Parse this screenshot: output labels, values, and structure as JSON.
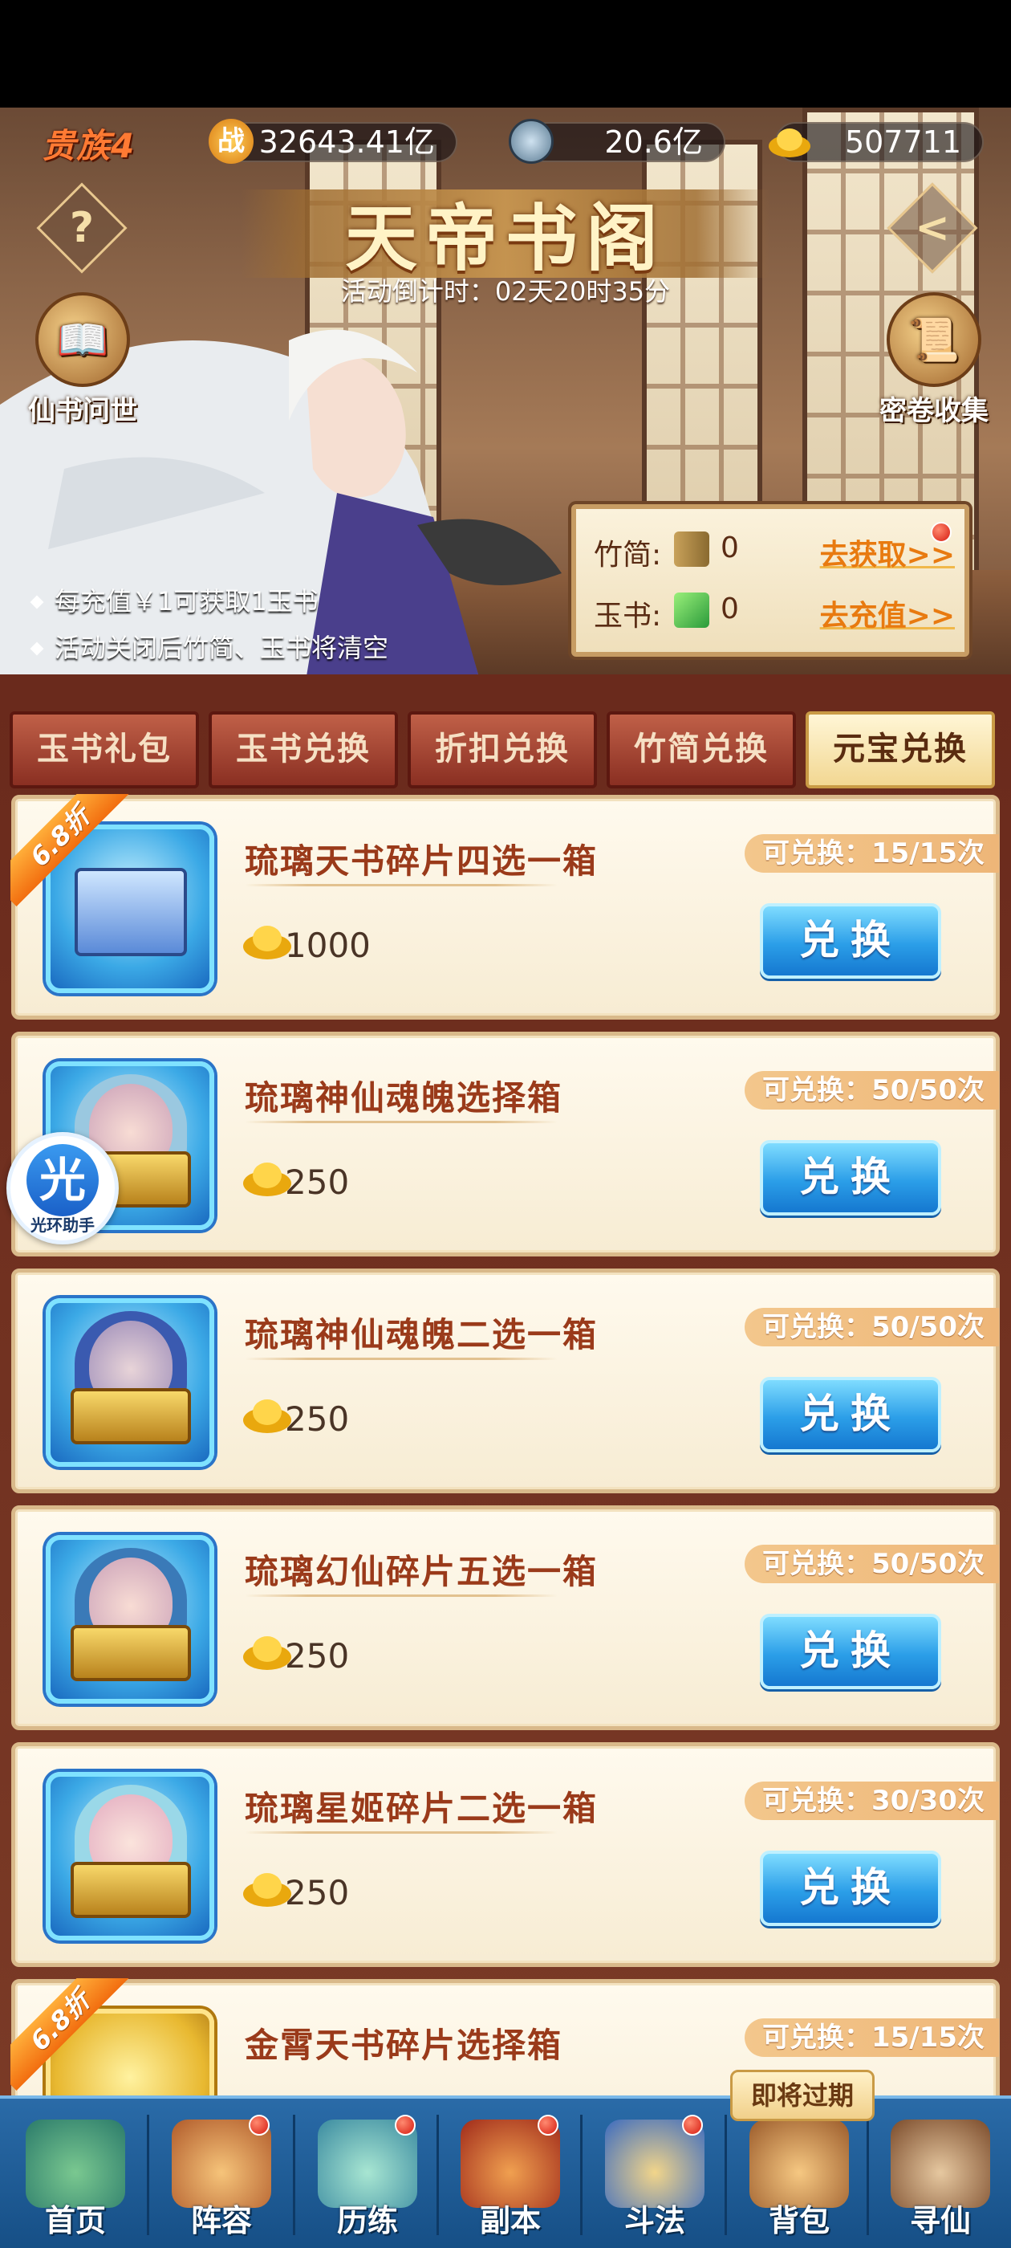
{
  "header": {
    "rank": "贵族4",
    "power_badge": "战",
    "power": "32643.41亿",
    "copper": "20.6亿",
    "ingots": "507711"
  },
  "banner": {
    "title": "天帝书阁",
    "countdown": "活动倒计时：02天20时35分",
    "left_button": "仙书问世",
    "right_button": "密卷收集",
    "info": [
      "每充值￥1可获取1玉书",
      "活动关闭后竹简、玉书将清空"
    ]
  },
  "resources": [
    {
      "label": "竹简:",
      "value": "0",
      "action": "去获取>>"
    },
    {
      "label": "玉书:",
      "value": "0",
      "action": "去充值>>"
    }
  ],
  "tabs": [
    "玉书礼包",
    "玉书兑换",
    "折扣兑换",
    "竹简兑换",
    "元宝兑换"
  ],
  "active_tab": 4,
  "items": [
    {
      "name": "琉璃天书碎片四选一箱",
      "price": "1000",
      "limit": "可兑换：15/15次",
      "discount": "6.8折",
      "button": "兑换"
    },
    {
      "name": "琉璃神仙魂魄选择箱",
      "price": "250",
      "limit": "可兑换：50/50次",
      "discount": "",
      "button": "兑换"
    },
    {
      "name": "琉璃神仙魂魄二选一箱",
      "price": "250",
      "limit": "可兑换：50/50次",
      "discount": "",
      "button": "兑换"
    },
    {
      "name": "琉璃幻仙碎片五选一箱",
      "price": "250",
      "limit": "可兑换：50/50次",
      "discount": "",
      "button": "兑换"
    },
    {
      "name": "琉璃星姬碎片二选一箱",
      "price": "250",
      "limit": "可兑换：30/30次",
      "discount": "",
      "button": "兑换"
    },
    {
      "name": "金霄天书碎片选择箱",
      "price": "",
      "limit": "可兑换：15/15次",
      "discount": "6.8折",
      "button": ""
    }
  ],
  "floating_assistant": {
    "big": "光",
    "small": "光环助手"
  },
  "expire_tip": "即将过期",
  "nav": [
    "首页",
    "阵容",
    "历练",
    "副本",
    "斗法",
    "背包",
    "寻仙"
  ],
  "colors": {
    "accent_blue": "#2b9ee8",
    "tab_red": "#8a2f22",
    "title_gold": "#fff3c6",
    "discount_orange": "#f26d0f"
  }
}
